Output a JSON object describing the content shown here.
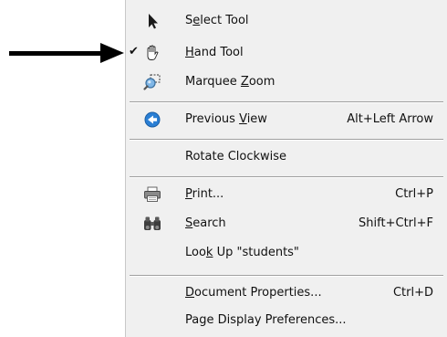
{
  "menu": {
    "items": [
      {
        "pre": "S",
        "key": "e",
        "post": "lect Tool",
        "shortcut": "",
        "checked": false,
        "icon": "arrow-cursor-icon"
      },
      {
        "pre": "",
        "key": "H",
        "post": "and Tool",
        "shortcut": "",
        "checked": true,
        "icon": "hand-icon"
      },
      {
        "pre": "Marquee ",
        "key": "Z",
        "post": "oom",
        "shortcut": "",
        "checked": false,
        "icon": "marquee-zoom-icon"
      },
      {
        "pre": "Previous ",
        "key": "V",
        "post": "iew",
        "shortcut": "Alt+Left Arrow",
        "checked": false,
        "icon": "previous-view-icon"
      },
      {
        "pre": "Rotate Clockwise",
        "key": "",
        "post": "",
        "shortcut": "",
        "checked": false,
        "icon": ""
      },
      {
        "pre": "",
        "key": "P",
        "post": "rint...",
        "shortcut": "Ctrl+P",
        "checked": false,
        "icon": "printer-icon"
      },
      {
        "pre": "",
        "key": "S",
        "post": "earch",
        "shortcut": "Shift+Ctrl+F",
        "checked": false,
        "icon": "binoculars-icon"
      },
      {
        "pre": "Loo",
        "key": "k",
        "post": " Up \"students\"",
        "shortcut": "",
        "checked": false,
        "icon": ""
      },
      {
        "pre": "",
        "key": "D",
        "post": "ocument Properties...",
        "shortcut": "Ctrl+D",
        "checked": false,
        "icon": ""
      },
      {
        "pre": "Page Display Preferences...",
        "key": "",
        "post": "",
        "shortcut": "",
        "checked": false,
        "icon": ""
      }
    ],
    "check_glyph": "✔"
  },
  "colors": {
    "menu_background": "#f0f0f0",
    "separator": "#a0a0a0",
    "pointer_arrow": "#000000",
    "previous_view_blue": "#2a7fd4"
  }
}
